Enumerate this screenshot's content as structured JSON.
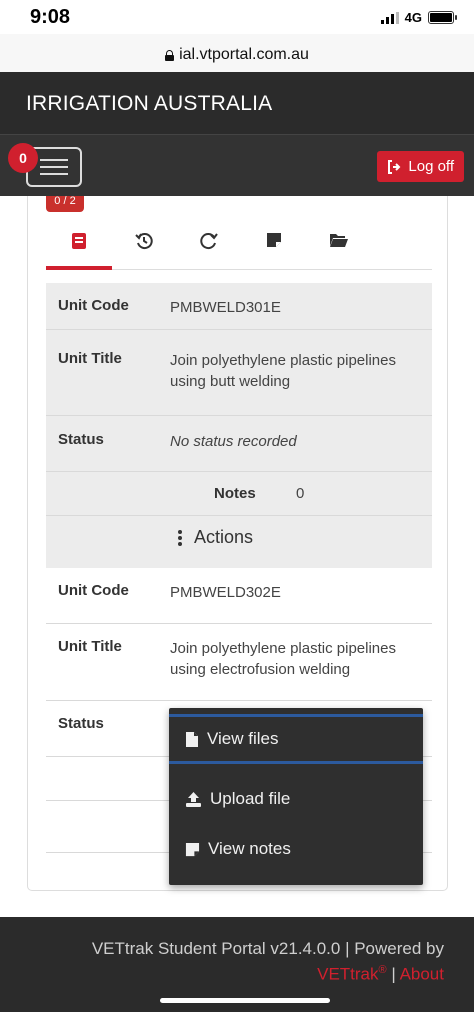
{
  "status_bar": {
    "time": "9:08",
    "network": "4G"
  },
  "browser": {
    "url": "ial.vtportal.com.au"
  },
  "header": {
    "title": "IRRIGATION AUSTRALIA"
  },
  "navbar": {
    "notification_count": "0",
    "logoff_label": "Log off"
  },
  "progress_badge": "0 / 2",
  "tabs": [
    {
      "icon": "book-icon",
      "active": true
    },
    {
      "icon": "history-icon",
      "active": false
    },
    {
      "icon": "redo-icon",
      "active": false
    },
    {
      "icon": "note-icon",
      "active": false
    },
    {
      "icon": "folder-open-icon",
      "active": false
    }
  ],
  "units": [
    {
      "code_label": "Unit Code",
      "code": "PMBWELD301E",
      "title_label": "Unit Title",
      "title": "Join polyethylene plastic pipelines using butt welding",
      "status_label": "Status",
      "status": "No status recorded",
      "notes_label": "Notes",
      "notes_count": "0",
      "actions_label": "Actions"
    },
    {
      "code_label": "Unit Code",
      "code": "PMBWELD302E",
      "title_label": "Unit Title",
      "title": "Join polyethylene plastic pipelines using electrofusion welding",
      "status_label": "Status"
    }
  ],
  "dropdown": {
    "items": [
      {
        "label": "View files",
        "icon": "file-icon"
      },
      {
        "label": "Upload file",
        "icon": "upload-icon"
      },
      {
        "label": "View notes",
        "icon": "note-icon"
      }
    ]
  },
  "footer": {
    "text": "VETtrak Student Portal v21.4.0.0 | Powered by",
    "brand": "VETtrak",
    "registered": "®",
    "separator": " | ",
    "about": "About"
  },
  "colors": {
    "accent": "#d0202e",
    "header_bg": "#2b2b2b",
    "highlight": "#2c5a9e"
  }
}
